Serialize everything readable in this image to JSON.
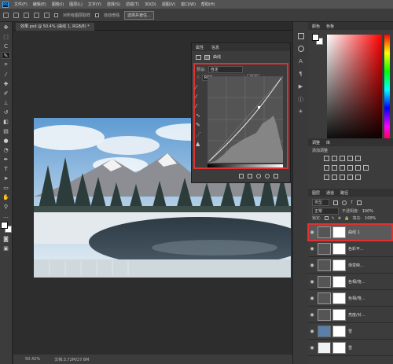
{
  "menu": [
    "PS",
    "文件(F)",
    "编辑(E)",
    "图像(I)",
    "图层(L)",
    "文字(Y)",
    "选择(S)",
    "滤镜(T)",
    "3D(D)",
    "视图(V)",
    "窗口(W)",
    "帮助(H)"
  ],
  "options": {
    "sample_all_layers": "对所有图层取样",
    "auto_enhance": "自动增强",
    "select_subject": "选择并遮住..."
  },
  "document": {
    "tab_title": "效果.psd @ 50.4% (曲线 1, RGB/8) *",
    "zoom": "50.42%",
    "doc_info": "文档:3.72M/27.6M"
  },
  "properties": {
    "tabs": [
      "属性",
      "信息"
    ],
    "adjustment_title": "曲线",
    "preset_label": "预设:",
    "preset_value": "自定",
    "channel_value": "RGB",
    "auto_button": "自动"
  },
  "right_panels": {
    "color_tabs": [
      "颜色",
      "色板"
    ],
    "adjust_tabs": [
      "调整",
      "库"
    ],
    "adjust_label": "添加调整",
    "layers_tabs": [
      "图层",
      "通道",
      "路径"
    ],
    "kind_label": "类型",
    "blend_mode": "正常",
    "opacity_label": "不透明度:",
    "opacity_value": "100%",
    "lock_label": "锁定:",
    "fill_label": "填充:",
    "fill_value": "100%"
  },
  "layers": [
    {
      "name": "曲线 1",
      "selected": true
    },
    {
      "name": "色彩平...",
      "selected": false
    },
    {
      "name": "渐变映...",
      "selected": false
    },
    {
      "name": "色相/饱...",
      "selected": false
    },
    {
      "name": "色相/饱...",
      "selected": false
    },
    {
      "name": "亮度/对...",
      "selected": false
    },
    {
      "name": "雪",
      "selected": false
    },
    {
      "name": "雪",
      "selected": false
    }
  ],
  "colors": {
    "highlight_box": "#e03030",
    "selected_layer": "#5a5a5a"
  }
}
